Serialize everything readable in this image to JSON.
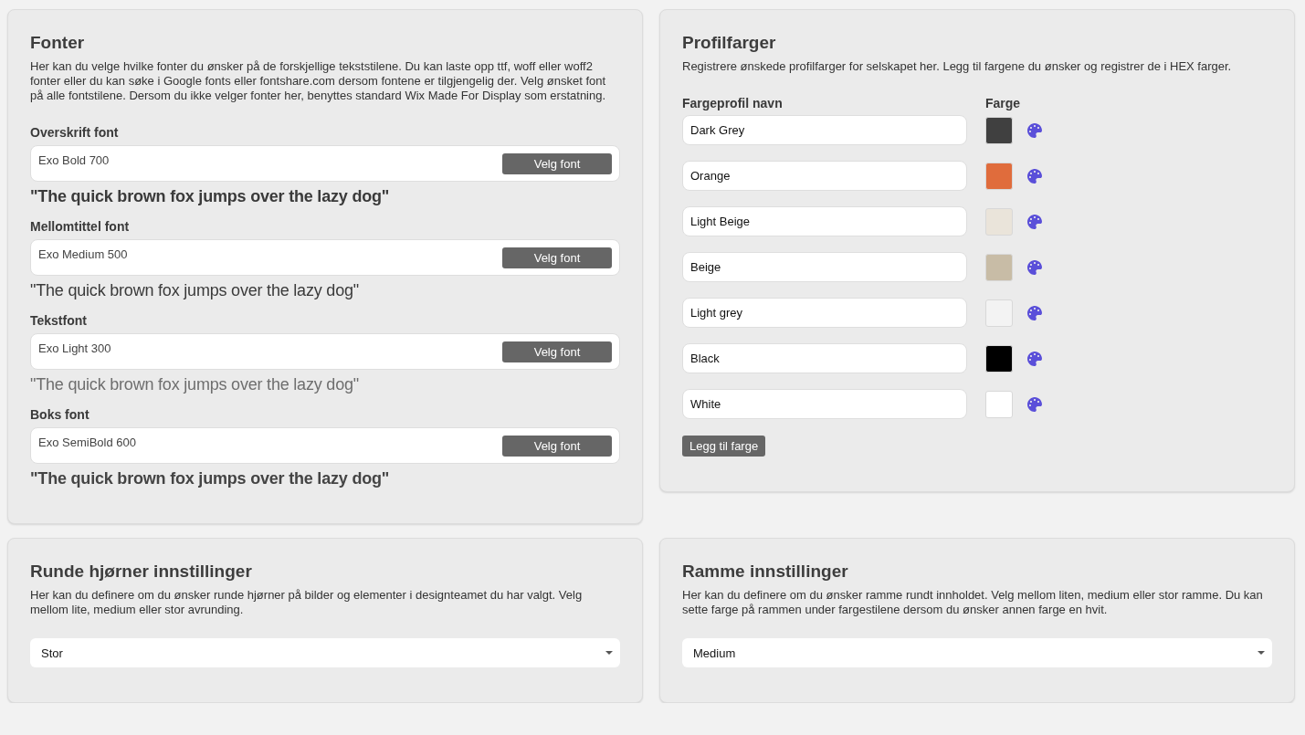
{
  "fonts_panel": {
    "title": "Fonter",
    "description": "Her kan du velge hvilke fonter du ønsker på de forskjellige tekststilene. Du kan laste opp ttf, woff eller woff2 fonter eller du kan søke i Google fonts eller fontshare.com dersom fontene er tilgjengelig der. Velg ønsket font på alle fontstilene. Dersom du ikke velger fonter her, benyttes standard Wix Made For Display som erstatning.",
    "fonts": [
      {
        "label": "Overskrift font",
        "value": "Exo Bold 700",
        "button": "Velg font",
        "sample": "\"The quick brown fox jumps over the lazy dog\"",
        "kind": "bold"
      },
      {
        "label": "Mellomtittel font",
        "value": "Exo Medium 500",
        "button": "Velg font",
        "sample": "\"The quick brown fox jumps over the lazy dog\"",
        "kind": "medium"
      },
      {
        "label": "Tekstfont",
        "value": "Exo Light 300",
        "button": "Velg font",
        "sample": "\"The quick brown fox jumps over the lazy dog\"",
        "kind": "light"
      },
      {
        "label": "Boks font",
        "value": "Exo SemiBold 600",
        "button": "Velg font",
        "sample": "\"The quick brown fox jumps over the lazy dog\"",
        "kind": "semibold"
      }
    ]
  },
  "colors_panel": {
    "title": "Profilfarger",
    "description": "Registrere ønskede profilfarger for selskapet her. Legg til fargene du ønsker og registrer de i HEX farger.",
    "columns": [
      "Fargeprofil navn",
      "Farge"
    ],
    "colors": [
      {
        "name": "Dark Grey",
        "color": "#404040"
      },
      {
        "name": "Orange",
        "color": "#e06c3c"
      },
      {
        "name": "Light Beige",
        "color": "#eae4da"
      },
      {
        "name": "Beige",
        "color": "#c8bca6"
      },
      {
        "name": "Light grey",
        "color": "#f3f3f3"
      },
      {
        "name": "Black",
        "color": "#000000"
      },
      {
        "name": "White",
        "color": "#ffffff"
      }
    ],
    "add_button": "Legg til farge"
  },
  "corners_panel": {
    "title": "Runde hjørner innstillinger",
    "description": "Her kan du definere om du ønsker runde hjørner på bilder og elementer i designteamet du har valgt. Velg mellom lite, medium eller stor avrunding.",
    "select": {
      "value": "Stor"
    }
  },
  "border_panel": {
    "title": "Ramme innstillinger",
    "description": "Her kan du definere om du ønsker ramme rundt innholdet. Velg mellom liten, medium eller stor ramme. Du kan sette farge på rammen under fargestilene dersom du ønsker annen farge en hvit.",
    "select": {
      "value": "Medium"
    }
  }
}
